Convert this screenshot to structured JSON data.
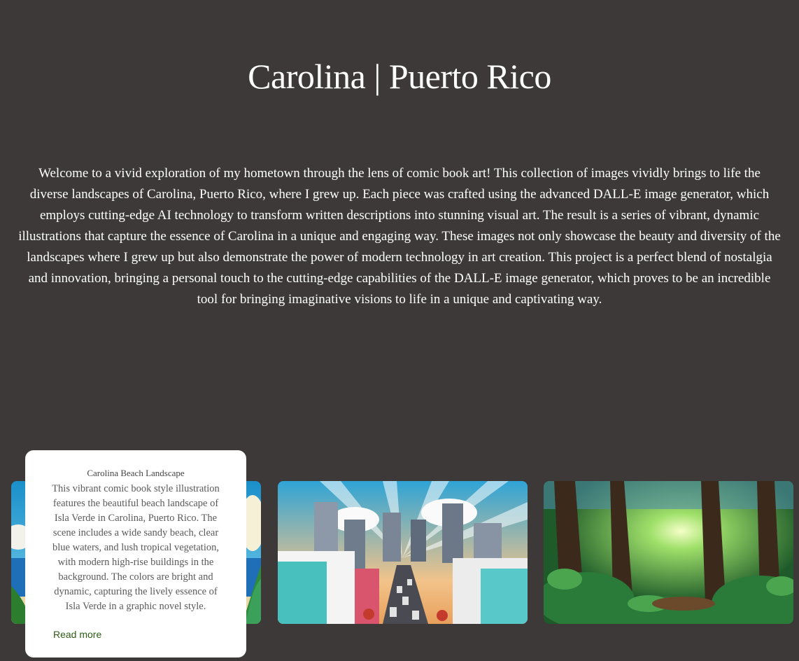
{
  "page": {
    "title": "Carolina | Puerto Rico",
    "intro": "Welcome to a vivid exploration of my hometown through the lens of comic book art! This collection of images vividly brings to life the diverse landscapes of Carolina, Puerto Rico, where I grew up. Each piece was crafted using the advanced DALL-E image generator, which employs cutting-edge AI technology to transform written descriptions into stunning visual art. The result is a series of vibrant, dynamic illustrations that capture the essence of Carolina in a unique and engaging way. These images not only showcase the beauty and diversity of the landscapes where I grew up but also demonstrate the power of modern technology in art creation. This project is a perfect blend of nostalgia and innovation, bringing a personal touch to the cutting-edge capabilities of the DALL-E image generator, which proves to be an incredible tool for bringing imaginative visions to life in a unique and captivating way."
  },
  "gallery": {
    "caption": {
      "title": "Carolina Beach Landscape",
      "text": "This vibrant comic book style illustration features the beautiful beach landscape of Isla Verde in Carolina, Puerto Rico. The scene includes a wide sandy beach, clear blue waters, and lush tropical vegetation, with modern high-rise buildings in the background. The colors are bright and dynamic, capturing the lively essence of Isla Verde in a graphic novel style.",
      "read_more": "Read more"
    },
    "images": [
      {
        "icon": "beach-illustration"
      },
      {
        "icon": "city-street-illustration"
      },
      {
        "icon": "forest-illustration"
      }
    ]
  },
  "colors": {
    "background": "#3d3939",
    "text": "#ffffff",
    "card": "#ffffff",
    "link": "#2e5b14"
  }
}
